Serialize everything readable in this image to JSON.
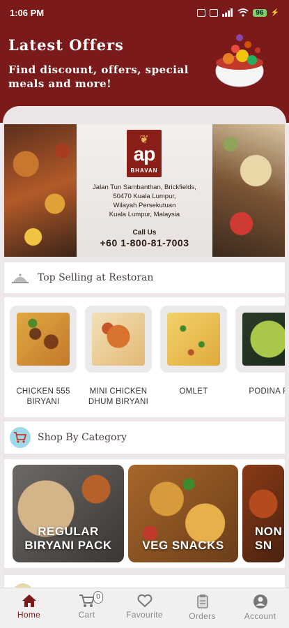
{
  "status_bar": {
    "time": "1:06 PM",
    "battery": "96"
  },
  "header": {
    "title": "Latest Offers",
    "subtitle": "Find discount, offers, special meals and more!"
  },
  "banner": {
    "logo_text": "ap",
    "logo_sub": "BHAVAN",
    "address_lines": [
      "Jalan Tun Sambanthan, Brickfields,",
      "50470 Kuala Lumpur,",
      "Wilayah Persekutuan",
      "Kuala Lumpur, Malaysia"
    ],
    "call_label": "Call Us",
    "phone": "+60 1-800-81-7003"
  },
  "top_selling": {
    "title": "Top Selling at Restoran",
    "items": [
      {
        "name": "CHICKEN 555 BIRYANI"
      },
      {
        "name": "MINI CHICKEN DHUM BIRYANI"
      },
      {
        "name": "OMLET"
      },
      {
        "name": "PODINA R"
      }
    ]
  },
  "shop_by_category": {
    "title": "Shop By Category",
    "items": [
      {
        "name": "REGULAR BIRYANI PACK"
      },
      {
        "name": "VEG SNACKS"
      },
      {
        "name": "NON SN"
      }
    ]
  },
  "bottom_nav": {
    "items": [
      {
        "label": "Home",
        "icon": "home-icon",
        "active": true
      },
      {
        "label": "Cart",
        "icon": "cart-icon",
        "badge": "0"
      },
      {
        "label": "Favourite",
        "icon": "heart-icon"
      },
      {
        "label": "Orders",
        "icon": "orders-icon"
      },
      {
        "label": "Account",
        "icon": "account-icon"
      }
    ]
  },
  "colors": {
    "brand": "#7a1a1a",
    "background": "#eee9ec"
  }
}
